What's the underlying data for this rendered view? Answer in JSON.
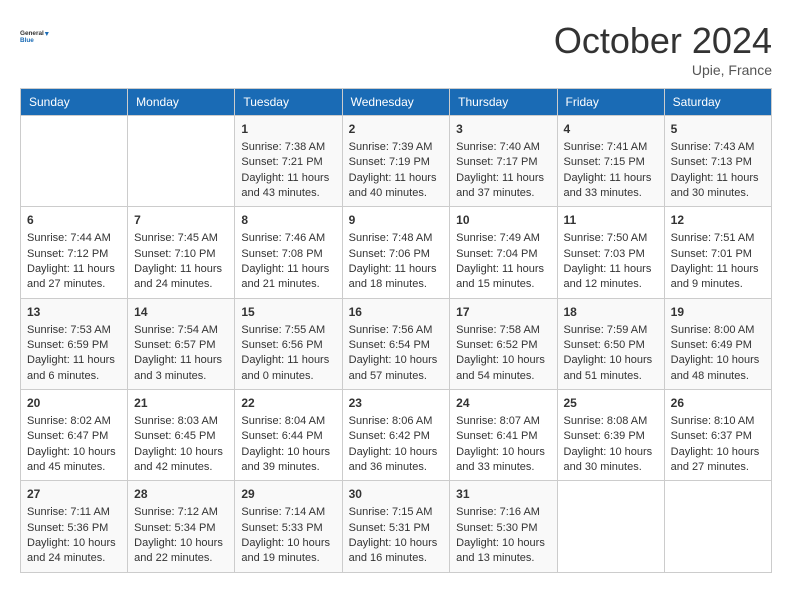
{
  "header": {
    "logo_line1": "General",
    "logo_line2": "Blue",
    "month_title": "October 2024",
    "location": "Upie, France"
  },
  "days_of_week": [
    "Sunday",
    "Monday",
    "Tuesday",
    "Wednesday",
    "Thursday",
    "Friday",
    "Saturday"
  ],
  "weeks": [
    [
      {
        "day": "",
        "sunrise": "",
        "sunset": "",
        "daylight": ""
      },
      {
        "day": "",
        "sunrise": "",
        "sunset": "",
        "daylight": ""
      },
      {
        "day": "1",
        "sunrise": "Sunrise: 7:38 AM",
        "sunset": "Sunset: 7:21 PM",
        "daylight": "Daylight: 11 hours and 43 minutes."
      },
      {
        "day": "2",
        "sunrise": "Sunrise: 7:39 AM",
        "sunset": "Sunset: 7:19 PM",
        "daylight": "Daylight: 11 hours and 40 minutes."
      },
      {
        "day": "3",
        "sunrise": "Sunrise: 7:40 AM",
        "sunset": "Sunset: 7:17 PM",
        "daylight": "Daylight: 11 hours and 37 minutes."
      },
      {
        "day": "4",
        "sunrise": "Sunrise: 7:41 AM",
        "sunset": "Sunset: 7:15 PM",
        "daylight": "Daylight: 11 hours and 33 minutes."
      },
      {
        "day": "5",
        "sunrise": "Sunrise: 7:43 AM",
        "sunset": "Sunset: 7:13 PM",
        "daylight": "Daylight: 11 hours and 30 minutes."
      }
    ],
    [
      {
        "day": "6",
        "sunrise": "Sunrise: 7:44 AM",
        "sunset": "Sunset: 7:12 PM",
        "daylight": "Daylight: 11 hours and 27 minutes."
      },
      {
        "day": "7",
        "sunrise": "Sunrise: 7:45 AM",
        "sunset": "Sunset: 7:10 PM",
        "daylight": "Daylight: 11 hours and 24 minutes."
      },
      {
        "day": "8",
        "sunrise": "Sunrise: 7:46 AM",
        "sunset": "Sunset: 7:08 PM",
        "daylight": "Daylight: 11 hours and 21 minutes."
      },
      {
        "day": "9",
        "sunrise": "Sunrise: 7:48 AM",
        "sunset": "Sunset: 7:06 PM",
        "daylight": "Daylight: 11 hours and 18 minutes."
      },
      {
        "day": "10",
        "sunrise": "Sunrise: 7:49 AM",
        "sunset": "Sunset: 7:04 PM",
        "daylight": "Daylight: 11 hours and 15 minutes."
      },
      {
        "day": "11",
        "sunrise": "Sunrise: 7:50 AM",
        "sunset": "Sunset: 7:03 PM",
        "daylight": "Daylight: 11 hours and 12 minutes."
      },
      {
        "day": "12",
        "sunrise": "Sunrise: 7:51 AM",
        "sunset": "Sunset: 7:01 PM",
        "daylight": "Daylight: 11 hours and 9 minutes."
      }
    ],
    [
      {
        "day": "13",
        "sunrise": "Sunrise: 7:53 AM",
        "sunset": "Sunset: 6:59 PM",
        "daylight": "Daylight: 11 hours and 6 minutes."
      },
      {
        "day": "14",
        "sunrise": "Sunrise: 7:54 AM",
        "sunset": "Sunset: 6:57 PM",
        "daylight": "Daylight: 11 hours and 3 minutes."
      },
      {
        "day": "15",
        "sunrise": "Sunrise: 7:55 AM",
        "sunset": "Sunset: 6:56 PM",
        "daylight": "Daylight: 11 hours and 0 minutes."
      },
      {
        "day": "16",
        "sunrise": "Sunrise: 7:56 AM",
        "sunset": "Sunset: 6:54 PM",
        "daylight": "Daylight: 10 hours and 57 minutes."
      },
      {
        "day": "17",
        "sunrise": "Sunrise: 7:58 AM",
        "sunset": "Sunset: 6:52 PM",
        "daylight": "Daylight: 10 hours and 54 minutes."
      },
      {
        "day": "18",
        "sunrise": "Sunrise: 7:59 AM",
        "sunset": "Sunset: 6:50 PM",
        "daylight": "Daylight: 10 hours and 51 minutes."
      },
      {
        "day": "19",
        "sunrise": "Sunrise: 8:00 AM",
        "sunset": "Sunset: 6:49 PM",
        "daylight": "Daylight: 10 hours and 48 minutes."
      }
    ],
    [
      {
        "day": "20",
        "sunrise": "Sunrise: 8:02 AM",
        "sunset": "Sunset: 6:47 PM",
        "daylight": "Daylight: 10 hours and 45 minutes."
      },
      {
        "day": "21",
        "sunrise": "Sunrise: 8:03 AM",
        "sunset": "Sunset: 6:45 PM",
        "daylight": "Daylight: 10 hours and 42 minutes."
      },
      {
        "day": "22",
        "sunrise": "Sunrise: 8:04 AM",
        "sunset": "Sunset: 6:44 PM",
        "daylight": "Daylight: 10 hours and 39 minutes."
      },
      {
        "day": "23",
        "sunrise": "Sunrise: 8:06 AM",
        "sunset": "Sunset: 6:42 PM",
        "daylight": "Daylight: 10 hours and 36 minutes."
      },
      {
        "day": "24",
        "sunrise": "Sunrise: 8:07 AM",
        "sunset": "Sunset: 6:41 PM",
        "daylight": "Daylight: 10 hours and 33 minutes."
      },
      {
        "day": "25",
        "sunrise": "Sunrise: 8:08 AM",
        "sunset": "Sunset: 6:39 PM",
        "daylight": "Daylight: 10 hours and 30 minutes."
      },
      {
        "day": "26",
        "sunrise": "Sunrise: 8:10 AM",
        "sunset": "Sunset: 6:37 PM",
        "daylight": "Daylight: 10 hours and 27 minutes."
      }
    ],
    [
      {
        "day": "27",
        "sunrise": "Sunrise: 7:11 AM",
        "sunset": "Sunset: 5:36 PM",
        "daylight": "Daylight: 10 hours and 24 minutes."
      },
      {
        "day": "28",
        "sunrise": "Sunrise: 7:12 AM",
        "sunset": "Sunset: 5:34 PM",
        "daylight": "Daylight: 10 hours and 22 minutes."
      },
      {
        "day": "29",
        "sunrise": "Sunrise: 7:14 AM",
        "sunset": "Sunset: 5:33 PM",
        "daylight": "Daylight: 10 hours and 19 minutes."
      },
      {
        "day": "30",
        "sunrise": "Sunrise: 7:15 AM",
        "sunset": "Sunset: 5:31 PM",
        "daylight": "Daylight: 10 hours and 16 minutes."
      },
      {
        "day": "31",
        "sunrise": "Sunrise: 7:16 AM",
        "sunset": "Sunset: 5:30 PM",
        "daylight": "Daylight: 10 hours and 13 minutes."
      },
      {
        "day": "",
        "sunrise": "",
        "sunset": "",
        "daylight": ""
      },
      {
        "day": "",
        "sunrise": "",
        "sunset": "",
        "daylight": ""
      }
    ]
  ]
}
